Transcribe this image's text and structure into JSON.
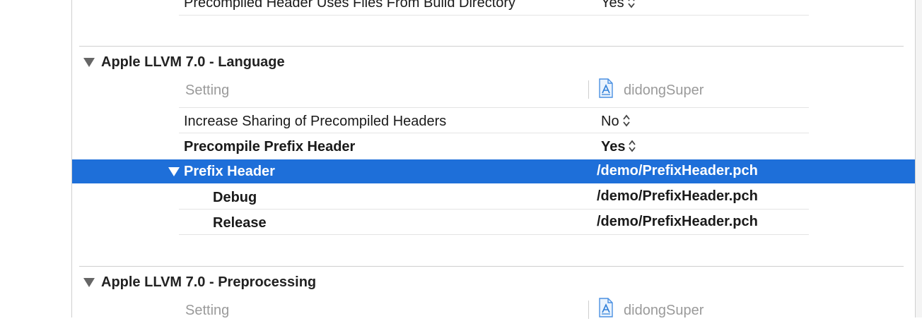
{
  "top_row": {
    "setting": "Precompiled Header Uses Files From Build Directory",
    "value": "Yes"
  },
  "sections": [
    {
      "title": "Apple LLVM 7.0 - Language",
      "header": {
        "setting": "Setting",
        "target": "didongSuper"
      },
      "rows": [
        {
          "setting": "Increase Sharing of Precompiled Headers",
          "value": "No"
        },
        {
          "setting": "Precompile Prefix Header",
          "value": "Yes"
        },
        {
          "setting": "Prefix Header",
          "value": "/demo/PrefixHeader.pch"
        },
        {
          "setting": "Debug",
          "value": "/demo/PrefixHeader.pch"
        },
        {
          "setting": "Release",
          "value": "/demo/PrefixHeader.pch"
        }
      ]
    },
    {
      "title": "Apple LLVM 7.0 - Preprocessing",
      "header": {
        "setting": "Setting",
        "target": "didongSuper"
      }
    }
  ],
  "colors": {
    "selection": "#1e6fd9",
    "muted_text": "#9a9a9a"
  },
  "icons": {
    "target": "xcode-app-target-icon",
    "disclosure": "disclosure-triangle-icon",
    "stepper": "popup-stepper-icon"
  }
}
